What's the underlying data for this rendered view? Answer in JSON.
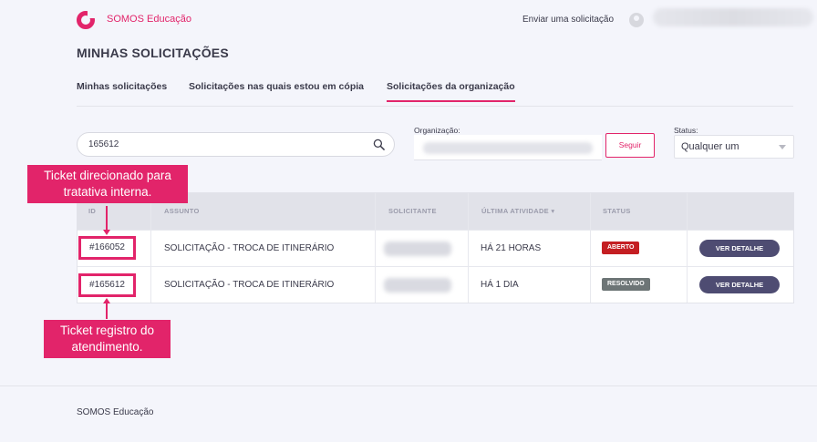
{
  "header": {
    "brand": "SOMOS Educação",
    "send_request": "Enviar uma solicitação"
  },
  "page_title": "MINHAS SOLICITAÇÕES",
  "tabs": [
    {
      "label": "Minhas solicitações"
    },
    {
      "label": "Solicitações nas quais estou em cópia"
    },
    {
      "label": "Solicitações da organização",
      "active": true
    }
  ],
  "filters": {
    "search_value": "165612",
    "org_label": "Organização:",
    "follow_button": "Seguir",
    "status_label": "Status:",
    "status_value": "Qualquer um"
  },
  "table": {
    "columns": [
      "ID",
      "ASSUNTO",
      "SOLICITANTE",
      "ÚLTIMA ATIVIDADE ▾",
      "STATUS"
    ],
    "rows": [
      {
        "id": "#166052",
        "subject": "SOLICITAÇÃO - TROCA DE ITINERÁRIO",
        "last_activity": "HÁ 21 HORAS",
        "status": "ABERTO",
        "action": "VER DETALHE"
      },
      {
        "id": "#165612",
        "subject": "SOLICITAÇÃO - TROCA DE ITINERÁRIO",
        "last_activity": "HÁ 1 DIA",
        "status": "RESOLVIDO",
        "action": "VER DETALHE"
      }
    ]
  },
  "annotations": {
    "top": "Ticket direcionado para tratativa interna.",
    "bottom": "Ticket registro do atendimento."
  },
  "footer": "SOMOS Educação",
  "colors": {
    "accent": "#e2246a",
    "status_open": "#c41e22",
    "status_resolved": "#6d7576",
    "detail_button": "#4e4c72"
  }
}
